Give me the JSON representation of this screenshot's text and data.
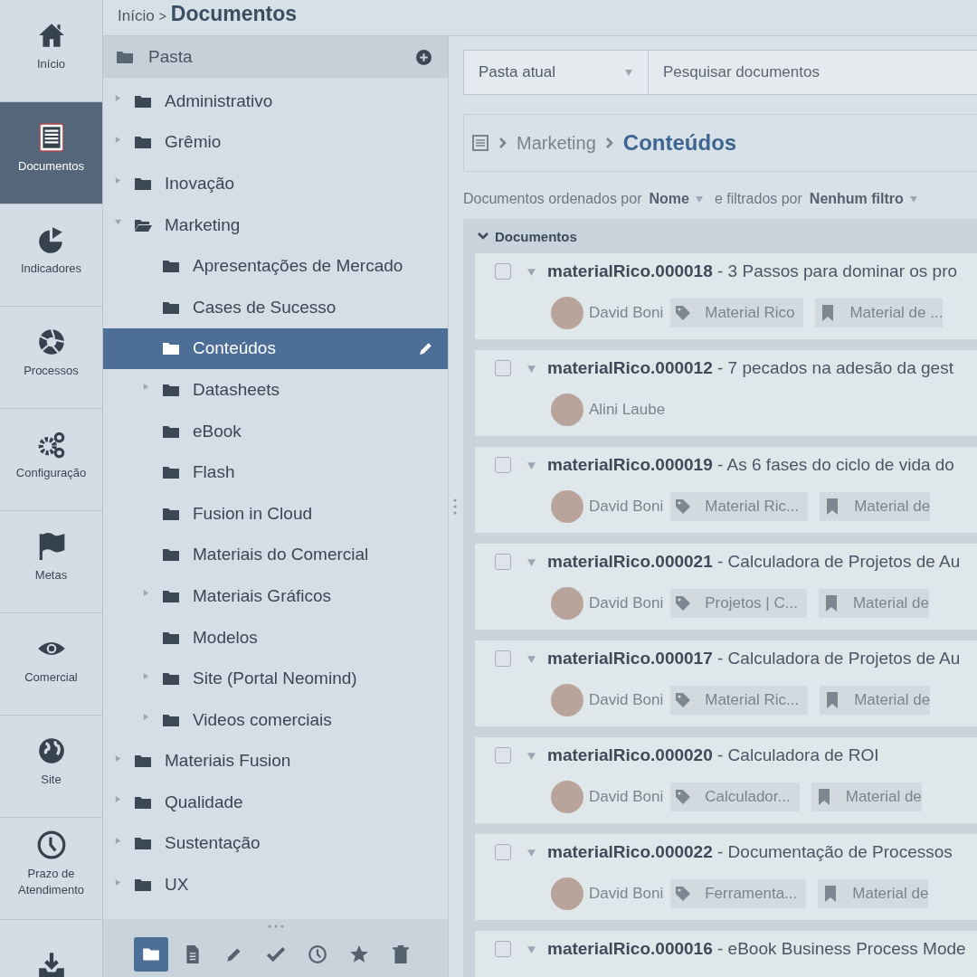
{
  "nav": [
    {
      "label": "Início",
      "selected": false
    },
    {
      "label": "Documentos",
      "selected": true
    },
    {
      "label": "Indicadores",
      "selected": false
    },
    {
      "label": "Processos",
      "selected": false
    },
    {
      "label": "Configuração",
      "selected": false
    },
    {
      "label": "Metas",
      "selected": false
    },
    {
      "label": "Comercial",
      "selected": false
    },
    {
      "label": "Site",
      "selected": false
    },
    {
      "label": "Prazo de Atendimento",
      "selected": false
    },
    {
      "selected": false
    }
  ],
  "breadcrumb": {
    "parent": "Início",
    "separator": ">",
    "current": "Documentos"
  },
  "tree": {
    "header": "Pasta",
    "items": [
      {
        "label": "Administrativo",
        "expandable": true,
        "expanded": false,
        "selected": false
      },
      {
        "label": "Grêmio",
        "expandable": true,
        "expanded": false,
        "selected": false
      },
      {
        "label": "Inovação",
        "expandable": true,
        "expanded": false,
        "selected": false
      },
      {
        "label": "Marketing",
        "expandable": true,
        "expanded": true,
        "selected": false,
        "children": [
          {
            "label": "Apresentações de Mercado",
            "expandable": false,
            "expanded": false,
            "selected": false
          },
          {
            "label": "Cases de Sucesso",
            "expandable": false,
            "expanded": false,
            "selected": false
          },
          {
            "label": "Conteúdos",
            "expandable": false,
            "expanded": false,
            "selected": true
          },
          {
            "label": "Datasheets",
            "expandable": true,
            "expanded": false,
            "selected": false
          },
          {
            "label": "eBook",
            "expandable": false,
            "expanded": false,
            "selected": false
          },
          {
            "label": "Flash",
            "expandable": false,
            "expanded": false,
            "selected": false
          },
          {
            "label": "Fusion in Cloud",
            "expandable": false,
            "expanded": false,
            "selected": false
          },
          {
            "label": "Materiais do Comercial",
            "expandable": false,
            "expanded": false,
            "selected": false
          },
          {
            "label": "Materiais Gráficos",
            "expandable": true,
            "expanded": false,
            "selected": false
          },
          {
            "label": "Modelos",
            "expandable": false,
            "expanded": false,
            "selected": false
          },
          {
            "label": "Site (Portal Neomind)",
            "expandable": true,
            "expanded": false,
            "selected": false
          },
          {
            "label": "Videos comerciais",
            "expandable": true,
            "expanded": false,
            "selected": false
          }
        ]
      },
      {
        "label": "Materiais Fusion",
        "expandable": true,
        "expanded": false,
        "selected": false
      },
      {
        "label": "Qualidade",
        "expandable": true,
        "expanded": false,
        "selected": false
      },
      {
        "label": "Sustentação",
        "expandable": true,
        "expanded": false,
        "selected": false
      },
      {
        "label": "UX",
        "expandable": true,
        "expanded": false,
        "selected": false
      }
    ]
  },
  "tree_toolbar": [
    {
      "selected": true
    },
    {
      "selected": false
    },
    {
      "selected": false
    },
    {
      "selected": false
    },
    {
      "selected": false
    },
    {
      "selected": false
    },
    {
      "selected": false
    }
  ],
  "search": {
    "scope": "Pasta atual",
    "placeholder": "Pesquisar documentos"
  },
  "folder_path": {
    "parent": "Marketing",
    "current": "Conteúdos"
  },
  "sort_line": {
    "prefix": "Documentos ordenados por",
    "sort": "Nome",
    "middle": "e filtrados por",
    "filter": "Nenhum filtro"
  },
  "group": {
    "title": "Documentos",
    "expanded": true
  },
  "documents": [
    {
      "title": "**materialRico.000018** - 3 Passos para dominar os pro",
      "checked": false,
      "author": "David Boni",
      "tag": "Material Rico",
      "category": "Material de ..."
    },
    {
      "title": "**materialRico.000012** - 7 pecados na adesão da gest",
      "checked": false,
      "author": "Alini Laube"
    },
    {
      "title": "**materialRico.000019** - As 6 fases do ciclo de vida do",
      "checked": false,
      "author": "David Boni",
      "tag": "Material Ric...",
      "category": "Material de"
    },
    {
      "title": "**materialRico.000021** - Calculadora de Projetos de Au",
      "checked": false,
      "author": "David Boni",
      "tag": "Projetos | C...",
      "category": "Material de"
    },
    {
      "title": "**materialRico.000017** - Calculadora de Projetos de Au",
      "checked": false,
      "author": "David Boni",
      "tag": "Material Ric...",
      "category": "Material de"
    },
    {
      "title": "**materialRico.000020** - Calculadora de ROI",
      "checked": false,
      "author": "David Boni",
      "tag": "Calculador...",
      "category": "Material de"
    },
    {
      "title": "**materialRico.000022** - Documentação de Processos",
      "checked": false,
      "author": "David Boni",
      "tag": "Ferramenta...",
      "category": "Material de"
    },
    {
      "title": "**materialRico.000016** - eBook Business Process Mode",
      "checked": false
    }
  ]
}
